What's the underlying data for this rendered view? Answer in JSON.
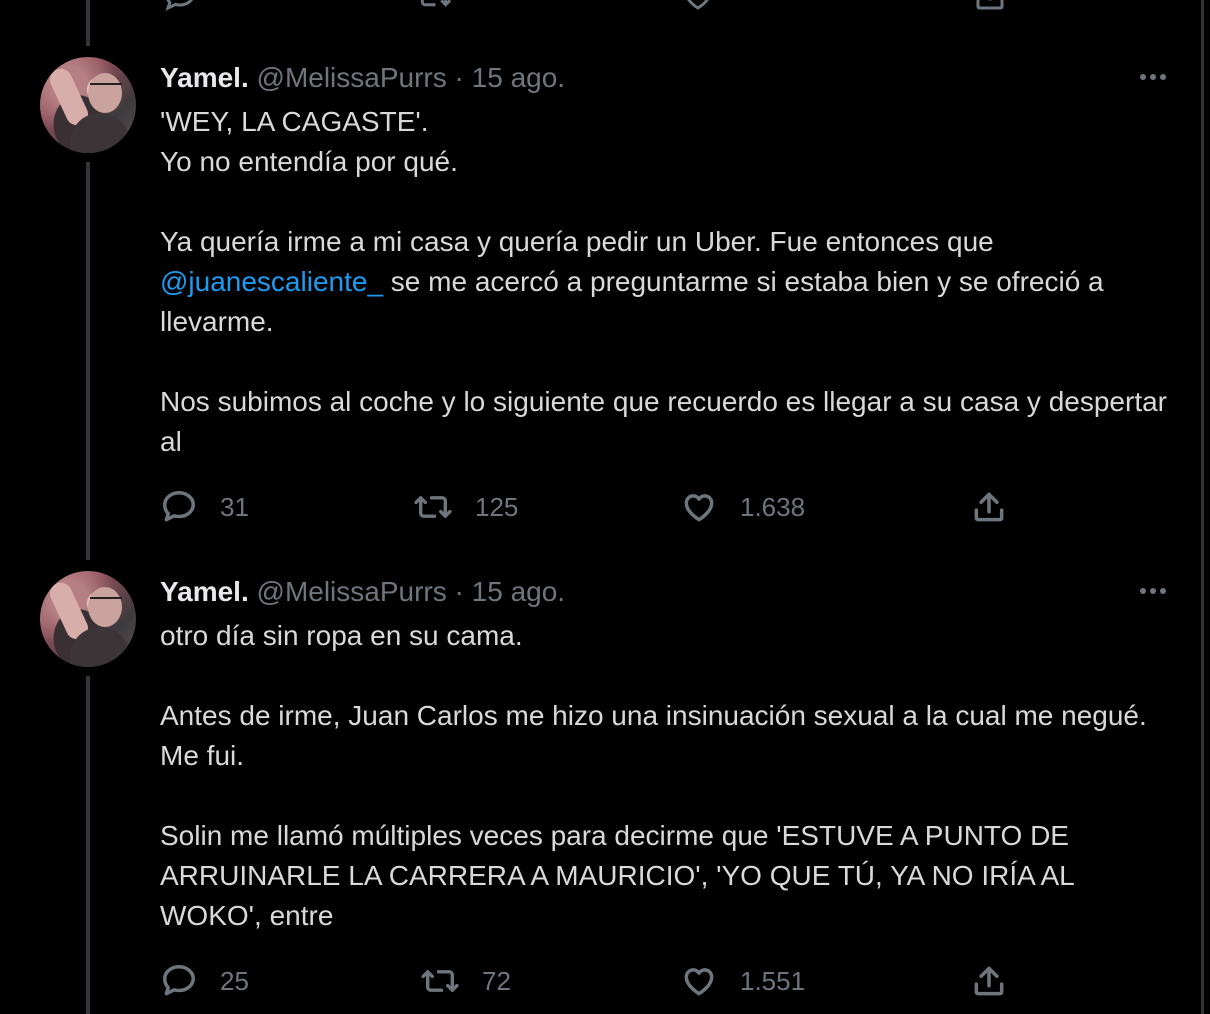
{
  "tweets": [
    {
      "name": "Yamel.",
      "handle": "@MelissaPurrs",
      "separator": "·",
      "date": "15 ago.",
      "text_lines": [
        "'WEY, LA CAGASTE'.",
        "Yo no entendía por qué."
      ],
      "para2_before": "Ya quería irme a mi casa y quería pedir un Uber. Fue entonces que ",
      "mention": "@juanescaliente_",
      "para2_after": " se me acercó a preguntarme si estaba bien y se ofreció a llevarme.",
      "para3": "Nos subimos al coche y lo siguiente que recuerdo es llegar a su casa y despertar al",
      "replies": "31",
      "retweets": "125",
      "likes": "1.638"
    },
    {
      "name": "Yamel.",
      "handle": "@MelissaPurrs",
      "separator": "·",
      "date": "15 ago.",
      "para1": "otro día sin ropa en su cama.",
      "para2": "Antes de irme, Juan Carlos me hizo una insinuación sexual a la cual me negué. Me fui.",
      "para3": "Solin me llamó múltiples veces para decirme que 'ESTUVE A PUNTO DE ARRUINARLE LA CARRERA A MAURICIO', 'YO QUE TÚ, YA NO IRÍA AL WOKO', entre",
      "replies": "25",
      "retweets": "72",
      "likes": "1.551"
    }
  ],
  "icons": {
    "avatar": "avatar",
    "more": "more-options-icon",
    "reply": "reply-icon",
    "retweet": "retweet-icon",
    "like": "like-icon",
    "share": "share-icon"
  },
  "colors": {
    "background": "#000000",
    "text": "#d9d9d9",
    "muted": "#6e767d",
    "mention": "#1d9bf0",
    "thread_line": "#333639"
  }
}
